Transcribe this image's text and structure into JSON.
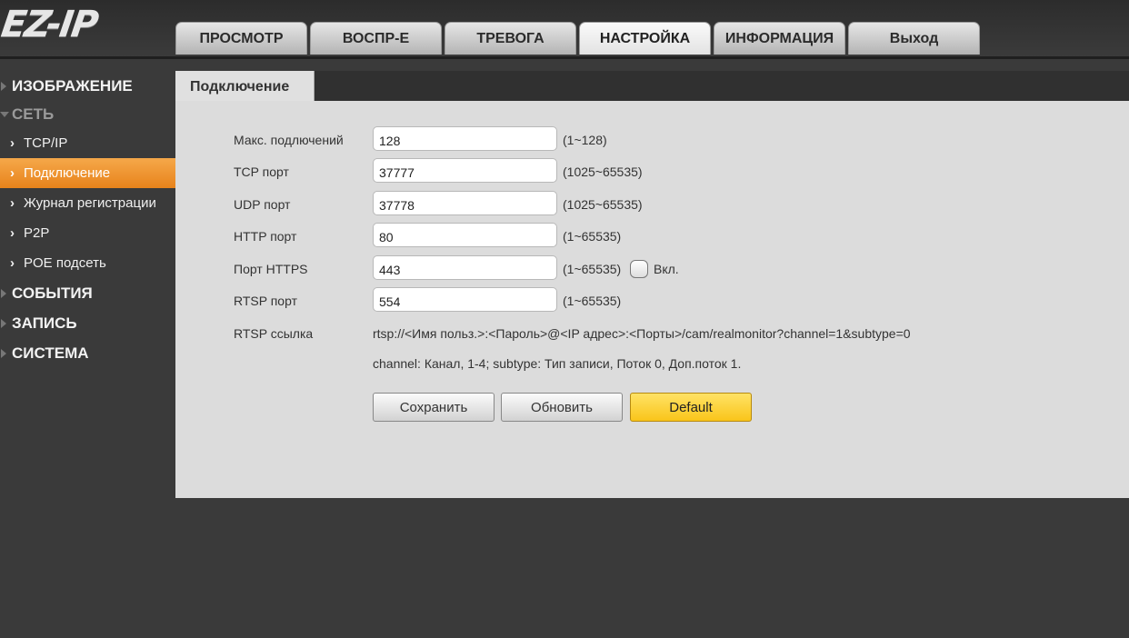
{
  "header": {
    "logo_text": "EZ-IP",
    "tabs": [
      "ПРОСМОТР",
      "ВОСПР-Е",
      "ТРЕВОГА",
      "НАСТРОЙКА",
      "ИНФОРМАЦИЯ",
      "Выход"
    ],
    "active_tab": "НАСТРОЙКА"
  },
  "sidebar": {
    "sections": [
      {
        "label": "ИЗОБРАЖЕНИЕ"
      },
      {
        "label": "СЕТЬ",
        "expanded": true
      },
      {
        "label": "СОБЫТИЯ"
      },
      {
        "label": "ЗАПИСЬ"
      },
      {
        "label": "СИСТЕМА"
      }
    ],
    "network_items": [
      "TCP/IP",
      "Подключение",
      "Журнал регистрации",
      "P2P",
      "POE подсеть"
    ],
    "active_item": "Подключение"
  },
  "content": {
    "tab_label": "Подключение",
    "fields": [
      {
        "label": "Макс. подлючений",
        "value": "128",
        "range": "(1~128)"
      },
      {
        "label": "TCP порт",
        "value": "37777",
        "range": "(1025~65535)"
      },
      {
        "label": "UDP порт",
        "value": "37778",
        "range": "(1025~65535)"
      },
      {
        "label": "HTTP порт",
        "value": "80",
        "range": "(1~65535)"
      },
      {
        "label": "Порт HTTPS",
        "value": "443",
        "range": "(1~65535)"
      },
      {
        "label": "RTSP порт",
        "value": "554",
        "range": "(1~65535)"
      }
    ],
    "https_checkbox": {
      "label": "Вкл.",
      "checked": false
    },
    "rtsp_link_label": "RTSP ссылка",
    "rtsp_link_value": "rtsp://<Имя польз.>:<Пароль>@<IP адрес>:<Порты>/cam/realmonitor?channel=1&subtype=0",
    "rtsp_note": "channel: Канал, 1-4; subtype: Тип записи, Поток 0, Доп.поток 1.",
    "buttons": {
      "save": "Сохранить",
      "refresh": "Обновить",
      "default": "Default"
    }
  },
  "colors": {
    "accent_orange": "#f0922e",
    "default_button": "#f9c51a",
    "background": "#3a3a3a",
    "panel": "#dcdcdc"
  }
}
